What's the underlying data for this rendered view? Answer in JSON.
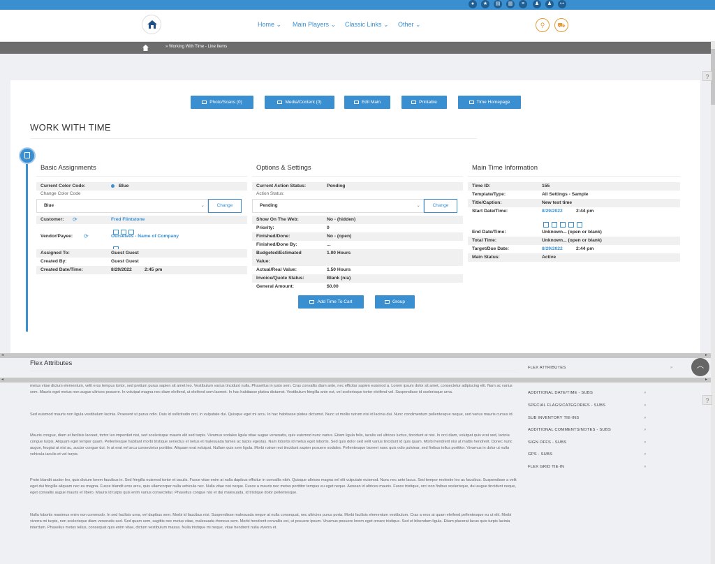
{
  "nav": {
    "links": [
      "Home",
      "Main Players",
      "Classic Links",
      "Other"
    ],
    "top_icons": [
      "globe-icon",
      "star-icon",
      "doc-icon",
      "print-icon",
      "list-icon",
      "user-icon",
      "user-add-icon",
      "logout-icon"
    ]
  },
  "breadcrumb": {
    "parent": "",
    "current": "Working With Time - Line Items"
  },
  "toolbar": {
    "buttons": [
      "Photo/Scans (0)",
      "Media/Content (0)",
      "Edit Main",
      "Printable",
      "Time Homepage"
    ]
  },
  "page": {
    "title": "WORK WITH TIME"
  },
  "basic": {
    "title": "Basic Assignments",
    "color_label": "Current Color Code:",
    "color_value": "Blue",
    "change_color_label": "Change Color Code",
    "color_select": "Blue",
    "change_btn": "Change",
    "customer_label": "Customer:",
    "customer_value": "Fred Flintstone",
    "vendor_label": "Vendor/Payee:",
    "vendor_value": "Ourselves - Name of Company",
    "assigned_label": "Assigned To:",
    "assigned_value": "Guest Guest",
    "created_by_label": "Created By:",
    "created_by_value": "Guest Guest",
    "created_dt_label": "Created Date/Time:",
    "created_date": "8/29/2022",
    "created_time": "2:45 pm"
  },
  "options": {
    "title": "Options & Settings",
    "action_label": "Current Action Status:",
    "action_value": "Pending",
    "action_sub": "Action Status:",
    "action_select": "Pending",
    "change_btn": "Change",
    "rows": [
      {
        "label": "Show On The Web:",
        "value": "No - (hidden)"
      },
      {
        "label": "Priority:",
        "value": "0"
      },
      {
        "label": "Finished/Done:",
        "value": "No - (open)"
      },
      {
        "label": "Finished/Done By:",
        "value": "..."
      },
      {
        "label": "Budgeted/Estimated",
        "value": "1.00 Hours"
      },
      {
        "label": "Value:",
        "value": ""
      },
      {
        "label": "Actual/Real Value:",
        "value": "1.50 Hours"
      },
      {
        "label": "Invoice/Quote Status:",
        "value": "Blank (n/a)"
      },
      {
        "label": "General Amount:",
        "value": "$0.00"
      }
    ],
    "add_btn": "Add Time To Cart",
    "group_btn": "Group"
  },
  "main_info": {
    "title": "Main Time Information",
    "time_id_label": "Time ID:",
    "time_id_value": "155",
    "template_label": "Template/Type:",
    "template_value": "All Settings - Sample",
    "caption_label": "Title/Caption:",
    "caption_value": "New test time",
    "start_label": "Start Date/Time:",
    "start_date": "8/29/2022",
    "start_time": "2:44 pm",
    "end_label": "End Date/Time:",
    "end_value": "Unknown... (open or blank)",
    "total_label": "Total Time:",
    "total_value": "Unknown... (open or blank)",
    "target_label": "Target/Due Date:",
    "target_date": "8/29/2022",
    "target_time": "2:44 pm",
    "status_label": "Main Status:",
    "status_value": "Active"
  },
  "flex": {
    "title": "Flex Attributes",
    "paragraphs": [
      "metus vitae dictum elementum, velit eros tempus tortor, sed pretium purus sapien sit amet leo. Vestibulum varius tincidunt nulla. Phasellus in justo sem. Cras convallis diam ante, nec efficitur sapien euismod a. Lorem ipsum dolor sit amet, consectetur adipiscing elit. Nam ac varius sem. Mauris eget metus non augue ultrices posuere. In volutpat magna nec diam eleifend, ut eleifend sem laoreet. In hac habitasse platea dictumst. Vestibulum fringilla ante est, vel scelerisque tortor eleifend vel. Suspendisse id scelerisque urna.",
      "Sed euismod mauris non ligula vestibulum lacinia. Praesent ut purus odio. Duis id sollicitudin orci, in vulputate dui. Quisque eget mi arcu. In hac habitasse platea dictumst. Nunc ut mollis rutrum nisi id lacinia dui. Nunc condimentum pellentesque neque, sed varius mauris cursus id.",
      "Mauris congue, diam at facilisis laoreet, tortor leo imperdiet nisi, sed scelerisque mauris elit sed turpis. Vivamus sodales ligula vitae augue venenatis, quis euismod nunc varius. Etiam ligula felis, iaculis vel ultrices luctus, tincidunt at nisi. In orci diam, volutpat quis erat sed, lacinia congue turpis. Aliquam eget tempor quam. Pellentesque habitant morbi tristique senectus et netus et malesuada fames ac turpis egestas. Nam lobortis id metus eget lobortis. Sed quis dolor sed velit varius tincidunt id quis quam. Morbi hendrerit nisi at mattis hendrerit. Donec nunc augue, feugiat at nisi ac, auctor congue dui. In at erat vel arcu consectetur porttitor. Aliquam erat volutpat. Nullam quis sem ligula. Morbi rutrum est tincidunt sapien posuere sodales. Pellentesque laoreet nunc quis odio pulvinar, sed finibus tellus porttitor. Vivamus in dolor ut nulla vehicula iaculis et vel turpis.",
      "Proin blandit auctor leo, quis dictum lorem faucibus in. Sed fringilla euismod tortor et iaculis. Fusce vitae enim at nulla dapibus efficitur in convallis nibh. Quisque ultrices magna vel elit vulputate euismod. Nunc nec ante lacus. Sed tempor molestie leo ac faucibus. Suspendisse a velit eget dui fringilla aliquam nec eu magna. Fusce blandit eros arcu, quis ullamcorper nulla vehicula nec. Nulla vitae nisi neque. Fusce a mauris nec metus porttitor tempus eu eget neque. Aenean id ultrices mauris. Fusce tristique, orci non finibus scelerisque, dui augue tincidunt neque, eget convallis augue mauris et libero. Mauris id turpis quis enim varius consectetur. Phasellus congue nisi et dui malesuada, id tristique dolor pellentesque.",
      "Nulla lobortis maximus enim non commodo. In sed facilisis urna, vel dapibus sem. Morbi id faucibus nisi. Suspendisse malesuada neque at nulla consequat, nec ultricies purus porta. Morbi facilisis elementum vestibulum. Cras a eros at quam eleifend pellentesque eu ut elit. Morbi viverra mi turpis, non scelerisque diam venenatis sed. Sed quam sem, sagittis nec metus vitae, malesuada rhoncus sem. Morbi hendrerit convallis est, ut posuere ipsum. Vivamus posuere lorem eget ornare tristique. Sed et bibendum ligula. Etiam placerat lacus quis turpis lacinia interdum. Phasellus metus tellus, consequat quis enim vitae, dictum vestibulum massa. Nulla tristique mi neque, vitae hendrerit nulla viverra et."
    ]
  },
  "sidebar": {
    "header": "FLEX ATTRIBUTES",
    "items": [
      "ADDITIONAL DATE/TIME - SUBS",
      "SPECIAL FLAGS/CATEGORIES - SUBS",
      "SUB INVENTORY TIE-INS",
      "ADDITIONAL COMMENTS/NOTES - SUBS",
      "SIGN OFFS - SUBS",
      "GPS - SUBS",
      "FLEX GRID TIE-IN"
    ],
    "arrow": "»"
  },
  "help": {
    "q": "?"
  },
  "colors": {
    "accent": "#3a8fd1",
    "orange": "#e29b3a"
  }
}
